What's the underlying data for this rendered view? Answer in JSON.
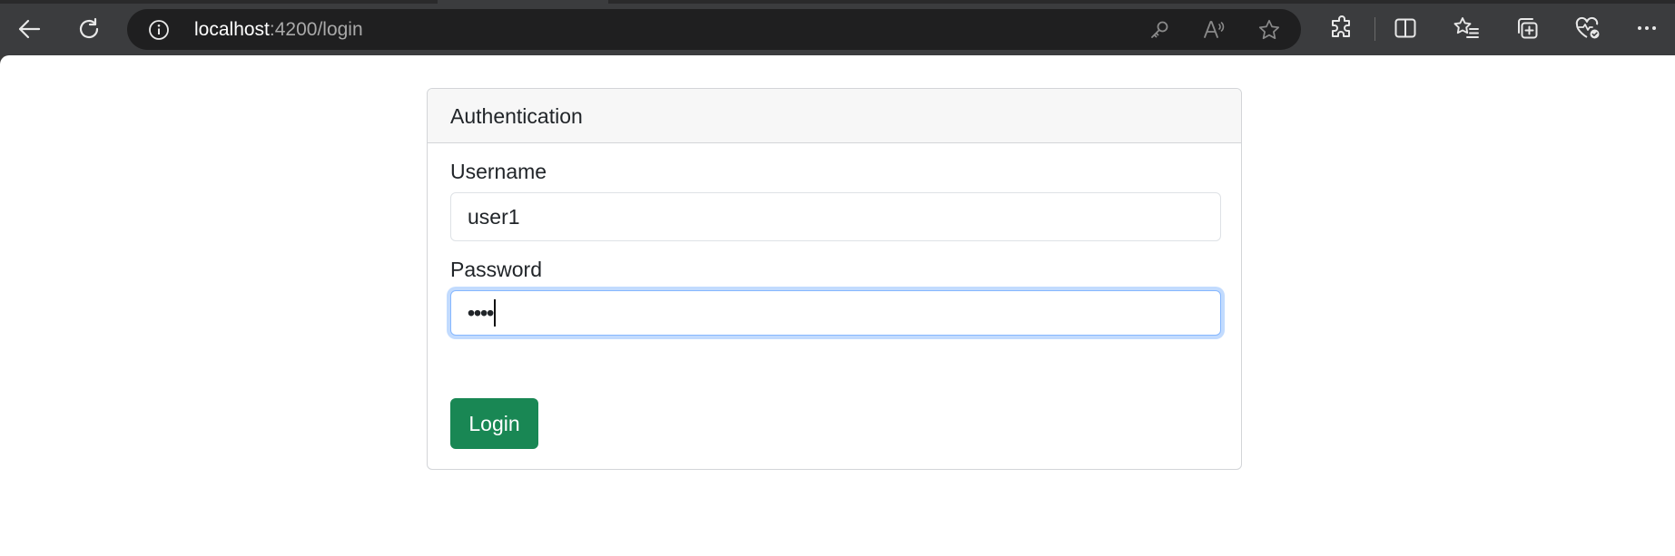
{
  "browser": {
    "url_host": "localhost",
    "url_rest": ":4200/login"
  },
  "card": {
    "title": "Authentication",
    "username_label": "Username",
    "username_value": "user1",
    "password_label": "Password",
    "password_masked": "••••",
    "login_label": "Login"
  },
  "colors": {
    "primary_button": "#198754",
    "focus_ring": "#86b7fe",
    "browser_chrome": "#3b3c3e"
  },
  "icons": [
    "back-arrow-icon",
    "refresh-icon",
    "info-icon",
    "key-icon",
    "read-aloud-icon",
    "favorite-star-icon",
    "extensions-icon",
    "split-screen-icon",
    "favorites-list-icon",
    "collections-icon",
    "browser-essentials-icon",
    "more-options-icon"
  ]
}
